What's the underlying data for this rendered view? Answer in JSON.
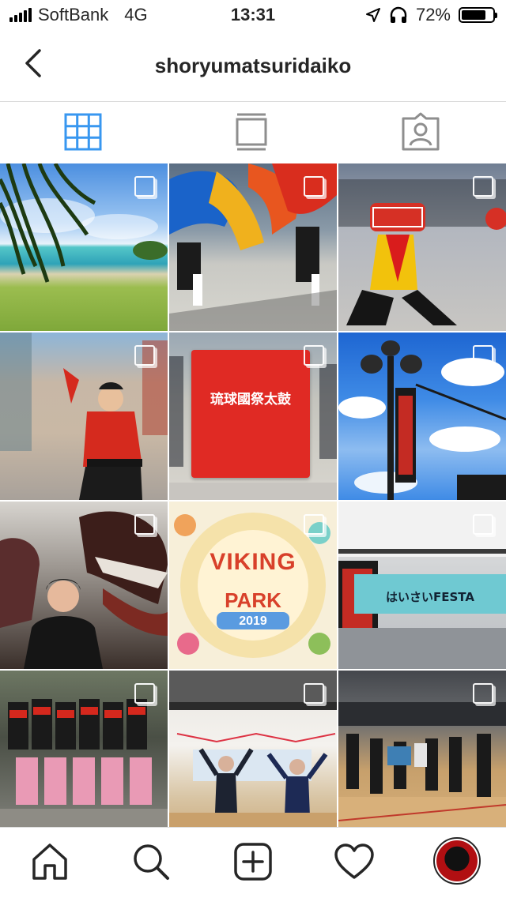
{
  "status_bar": {
    "carrier": "SoftBank",
    "network": "4G",
    "time": "13:31",
    "battery": "72%",
    "battery_level": 0.72,
    "icons": [
      "signal-bars-icon",
      "location-arrow-icon",
      "headphones-icon",
      "battery-icon"
    ]
  },
  "header": {
    "title": "shoryumatsuridaiko",
    "back_icon": "chevron-left-icon"
  },
  "view_tabs": [
    {
      "name": "grid-view",
      "icon": "grid-icon",
      "active": true
    },
    {
      "name": "feed-view",
      "icon": "feed-icon",
      "active": false
    },
    {
      "name": "tagged-view",
      "icon": "tagged-person-icon",
      "active": false
    }
  ],
  "posts": [
    {
      "scene": "beach-with-palm-leaves",
      "multi": true
    },
    {
      "scene": "flag-dancers-parade",
      "multi": true
    },
    {
      "scene": "drummer-in-street",
      "multi": true
    },
    {
      "scene": "dancer-in-red-costume",
      "multi": true
    },
    {
      "scene": "red-banner-on-stage",
      "multi": true,
      "banner_text": "琉球國祭太鼓"
    },
    {
      "scene": "banner-on-pole-blue-sky",
      "multi": true
    },
    {
      "scene": "lion-dance-selfie",
      "multi": true
    },
    {
      "scene": "viking-park-poster",
      "multi": true,
      "poster_title": "VIKING",
      "poster_subtitle": "PARK",
      "poster_year": "2019"
    },
    {
      "scene": "indoor-festa-banner",
      "multi": true,
      "banner_text": "はいさいFESTA"
    },
    {
      "scene": "group-photo-performers",
      "multi": true
    },
    {
      "scene": "two-men-in-hall",
      "multi": true
    },
    {
      "scene": "gym-practice",
      "multi": true
    }
  ],
  "bottom_nav": [
    {
      "name": "home",
      "icon": "home-icon"
    },
    {
      "name": "search",
      "icon": "search-icon"
    },
    {
      "name": "new-post",
      "icon": "add-post-icon"
    },
    {
      "name": "activity",
      "icon": "heart-icon"
    },
    {
      "name": "profile",
      "icon": "profile-avatar-icon"
    }
  ],
  "colors": {
    "accent": "#3897f0",
    "text": "#262626",
    "divider": "#dbdbdb",
    "inactive_icon": "#8e8e8e"
  }
}
